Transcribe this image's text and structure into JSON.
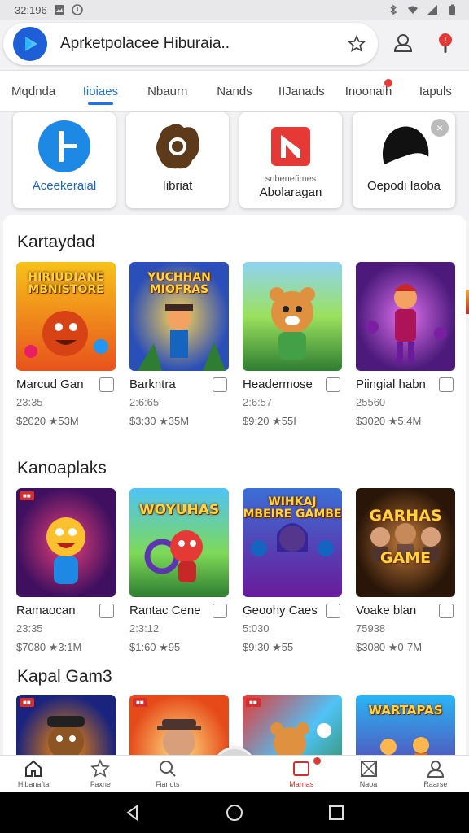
{
  "status_bar": {
    "time": "32:196"
  },
  "search": {
    "text": "Aprketpolacee Hiburaia.."
  },
  "tabs": [
    {
      "label": "Mqdnda"
    },
    {
      "label": "Iioiaes"
    },
    {
      "label": "Nbaurn"
    },
    {
      "label": "Nands"
    },
    {
      "label": "IIJanads"
    },
    {
      "label": "Inoonaih"
    },
    {
      "label": "Iapuls"
    }
  ],
  "featured": [
    {
      "label": "Aceekeraial",
      "color": "#1e88e5"
    },
    {
      "label": "Iibriat",
      "color": "#5d3a1a"
    },
    {
      "label": "Abolaragan",
      "sub": "snbenefimes",
      "color": "#e53935"
    },
    {
      "label": "Oepodi Iaoba",
      "color": "#111111"
    }
  ],
  "sections": [
    {
      "title": "Kartaydad",
      "games": [
        {
          "name": "Marcud Gan",
          "size": "23:35",
          "price": "$2020 ★53M",
          "art": "HIRIUDIANE MBNISTORE",
          "bg": [
            "#f7c21a",
            "#e8521c"
          ]
        },
        {
          "name": "Barkntra",
          "size": "2:6:65",
          "price": "$3:30 ★35M",
          "art": "YUCHHAN MIOFRAS",
          "bg": [
            "#ff9d2e",
            "#2b4fb8"
          ]
        },
        {
          "name": "Headermose",
          "size": "2:6:57",
          "price": "$9:20 ★55I",
          "art": "",
          "bg": [
            "#9be15d",
            "#2e9d3a"
          ]
        },
        {
          "name": "Piingial habn",
          "size": "25560",
          "price": "$3020 ★5:4M",
          "art": "",
          "bg": [
            "#c84fd8",
            "#4b1a7a"
          ]
        }
      ]
    },
    {
      "title": "Kanoaplaks",
      "games": [
        {
          "name": "Ramaocan",
          "size": "23:35",
          "price": "$7080 ★3:1M",
          "art": "",
          "bg": [
            "#c2185b",
            "#3f1060"
          ]
        },
        {
          "name": "Rantac Cene",
          "size": "2:3:12",
          "price": "$1:60 ★95",
          "art": "WOYUHAS",
          "bg": [
            "#7ed957",
            "#1e6e9e"
          ]
        },
        {
          "name": "Geoohy Caes",
          "size": "5:030",
          "price": "$9:30 ★55",
          "art": "WIHKAJ MBEIRE GAMBE",
          "bg": [
            "#3b6fd6",
            "#6a1b9a"
          ]
        },
        {
          "name": "Voake blan",
          "size": "75938",
          "price": "$3080 ★0-7M",
          "art": "GARHAS GAME",
          "bg": [
            "#8b4513",
            "#2a1608"
          ]
        }
      ]
    },
    {
      "title": "Kapal Gam3",
      "games": [
        {
          "name": "",
          "art": "",
          "bg": [
            "#ff8a00",
            "#1a237e"
          ]
        },
        {
          "name": "",
          "art": "",
          "bg": [
            "#ffb300",
            "#e64a19"
          ]
        },
        {
          "name": "",
          "art": "",
          "bg": [
            "#4fc3f7",
            "#2e7d32"
          ]
        },
        {
          "name": "",
          "art": "WARTAPAS",
          "bg": [
            "#29b6f6",
            "#6a1b9a"
          ]
        }
      ]
    }
  ],
  "bottom_nav": [
    {
      "label": "Hibanafta"
    },
    {
      "label": "Faxne"
    },
    {
      "label": "Fianots"
    },
    {
      "label": ""
    },
    {
      "label": "Marnas"
    },
    {
      "label": "Naoa"
    },
    {
      "label": "Raarse"
    }
  ]
}
